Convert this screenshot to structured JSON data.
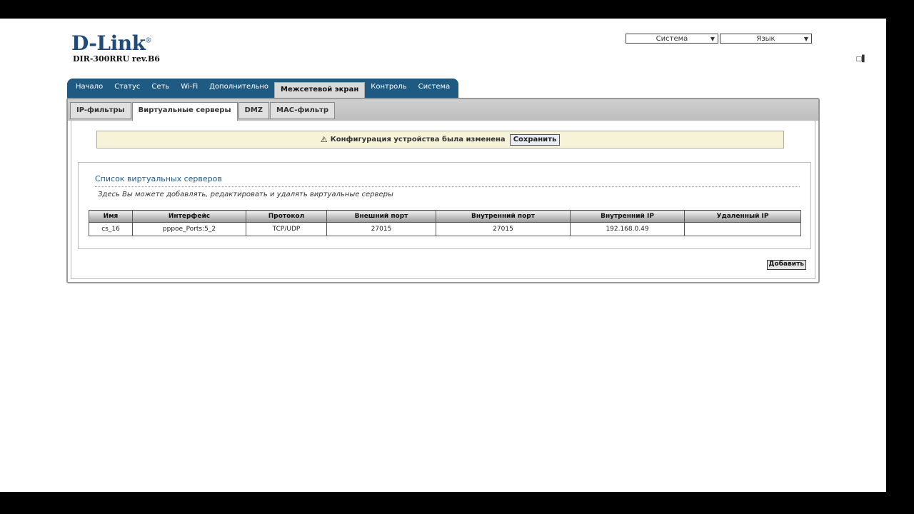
{
  "logo": {
    "brand": "D-Link",
    "mark": "®"
  },
  "model": "DIR-300RRU rev.B6",
  "header": {
    "system_select": "Система",
    "language_select": "Язык",
    "corner_text": "□▌"
  },
  "main_nav": {
    "items": [
      {
        "label": "Начало"
      },
      {
        "label": "Статус"
      },
      {
        "label": "Сеть"
      },
      {
        "label": "Wi-Fi"
      },
      {
        "label": "Дополнительно"
      },
      {
        "label": "Межсетевой экран",
        "active": true
      },
      {
        "label": "Контроль"
      },
      {
        "label": "Система"
      }
    ]
  },
  "sub_tabs": [
    {
      "label": "IP-фильтры"
    },
    {
      "label": "Виртуальные серверы",
      "active": true
    },
    {
      "label": "DMZ"
    },
    {
      "label": "MAC-фильтр"
    }
  ],
  "notice": {
    "text": "Конфигурация устройства была изменена",
    "button": "Сохранить"
  },
  "section": {
    "title": "Список виртуальных серверов",
    "description": "Здесь Вы можете добавлять, редактировать и удалять виртуальные серверы"
  },
  "table": {
    "columns": [
      "Имя",
      "Интерфейс",
      "Протокол",
      "Внешний порт",
      "Внутренний порт",
      "Внутренний IP",
      "Удаленный IP"
    ],
    "rows": [
      [
        "cs_16",
        "pppoe_Ports:5_2",
        "TCP/UDP",
        "27015",
        "27015",
        "192.168.0.49",
        ""
      ]
    ]
  },
  "add_button": "Добавить"
}
